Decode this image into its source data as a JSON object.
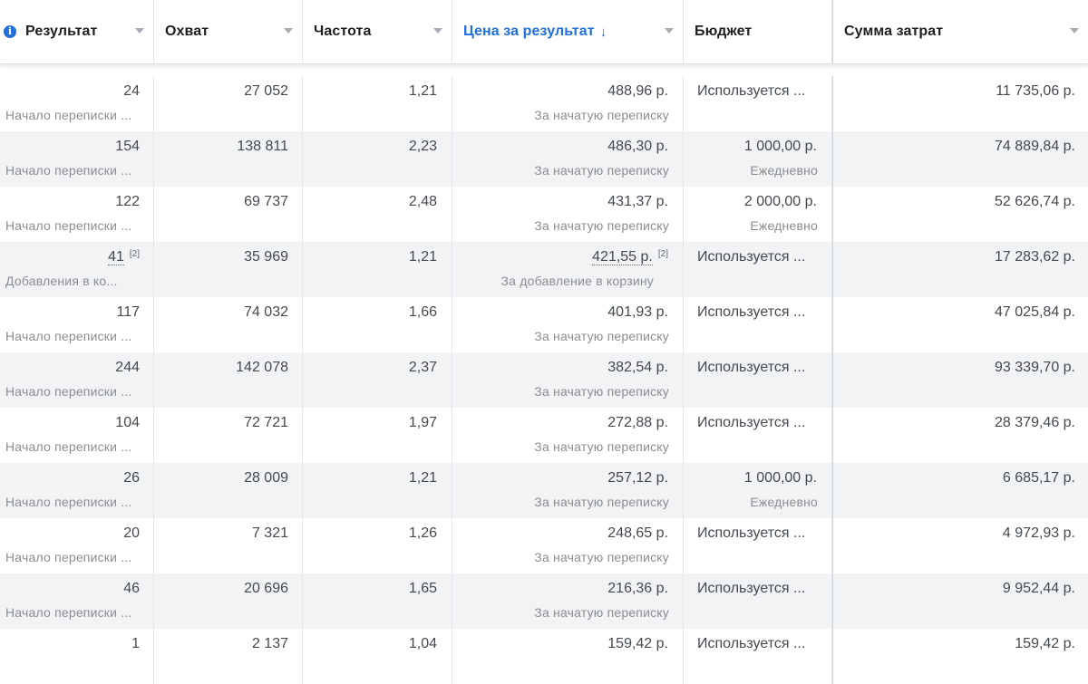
{
  "columns": [
    {
      "label": "Результат",
      "active": false
    },
    {
      "label": "Охват",
      "active": false
    },
    {
      "label": "Частота",
      "active": false
    },
    {
      "label": "Цена за результат",
      "active": true,
      "sort": "↓"
    },
    {
      "label": "Бюджет",
      "active": false
    },
    {
      "label": "Сумма затрат",
      "active": false
    }
  ],
  "rows": [
    {
      "result": "24",
      "result_type": "Начало переписки ...",
      "reach": "27 052",
      "frequency": "1,21",
      "cost": "488,96 р.",
      "cost_sub": "За начатую переписку",
      "budget": "Используется ...",
      "budget_sub": "",
      "spent": "11 735,06 р."
    },
    {
      "result": "154",
      "result_type": "Начало переписки ...",
      "reach": "138 811",
      "frequency": "2,23",
      "cost": "486,30 р.",
      "cost_sub": "За начатую переписку",
      "budget": "1 000,00 р.",
      "budget_sub": "Ежедневно",
      "spent": "74 889,84 р."
    },
    {
      "result": "122",
      "result_type": "Начало переписки ...",
      "reach": "69 737",
      "frequency": "2,48",
      "cost": "431,37 р.",
      "cost_sub": "За начатую переписку",
      "budget": "2 000,00 р.",
      "budget_sub": "Ежедневно",
      "spent": "52 626,74 р."
    },
    {
      "result": "41",
      "result_note": "[2]",
      "result_type": "Добавления в ко...",
      "reach": "35 969",
      "frequency": "1,21",
      "cost": "421,55 р.",
      "cost_note": "[2]",
      "cost_sub": "За добавление в корзину",
      "budget": "Используется ...",
      "budget_sub": "",
      "spent": "17 283,62 р."
    },
    {
      "result": "117",
      "result_type": "Начало переписки ...",
      "reach": "74 032",
      "frequency": "1,66",
      "cost": "401,93 р.",
      "cost_sub": "За начатую переписку",
      "budget": "Используется ...",
      "budget_sub": "",
      "spent": "47 025,84 р."
    },
    {
      "result": "244",
      "result_type": "Начало переписки ...",
      "reach": "142 078",
      "frequency": "2,37",
      "cost": "382,54 р.",
      "cost_sub": "За начатую переписку",
      "budget": "Используется ...",
      "budget_sub": "",
      "spent": "93 339,70 р."
    },
    {
      "result": "104",
      "result_type": "Начало переписки ...",
      "reach": "72 721",
      "frequency": "1,97",
      "cost": "272,88 р.",
      "cost_sub": "За начатую переписку",
      "budget": "Используется ...",
      "budget_sub": "",
      "spent": "28 379,46 р."
    },
    {
      "result": "26",
      "result_type": "Начало переписки ...",
      "reach": "28 009",
      "frequency": "1,21",
      "cost": "257,12 р.",
      "cost_sub": "За начатую переписку",
      "budget": "1 000,00 р.",
      "budget_sub": "Ежедневно",
      "spent": "6 685,17 р."
    },
    {
      "result": "20",
      "result_type": "Начало переписки ...",
      "reach": "7 321",
      "frequency": "1,26",
      "cost": "248,65 р.",
      "cost_sub": "За начатую переписку",
      "budget": "Используется ...",
      "budget_sub": "",
      "spent": "4 972,93 р."
    },
    {
      "result": "46",
      "result_type": "Начало переписки ...",
      "reach": "20 696",
      "frequency": "1,65",
      "cost": "216,36 р.",
      "cost_sub": "За начатую переписку",
      "budget": "Используется ...",
      "budget_sub": "",
      "spent": "9 952,44 р."
    },
    {
      "result": "1",
      "result_type": "",
      "reach": "2 137",
      "frequency": "1,04",
      "cost": "159,42 р.",
      "cost_sub": "",
      "budget": "Используется ...",
      "budget_sub": "",
      "spent": "159,42 р."
    }
  ],
  "icons": {
    "info": "info-icon",
    "sort": "sort-down-arrow-icon",
    "caret": "caret-down-icon"
  },
  "colors": {
    "accent": "#216fdb",
    "row_alt": "#f2f3f5",
    "muted_text": "#8a8d91"
  }
}
